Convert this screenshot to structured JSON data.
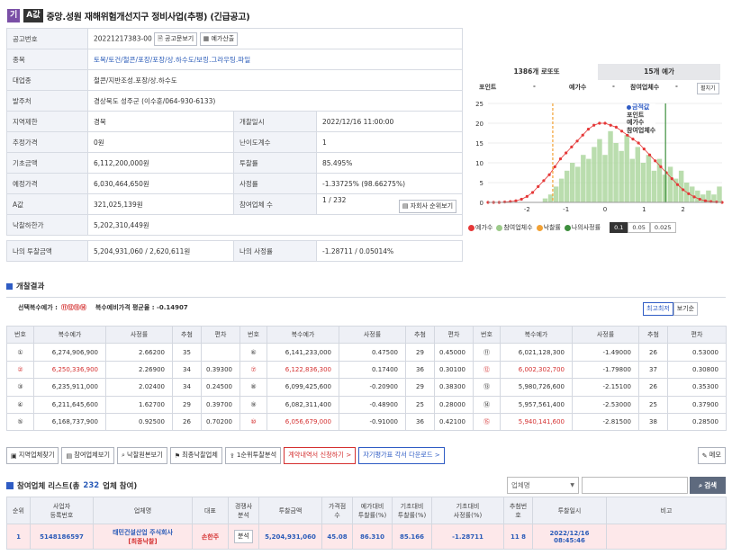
{
  "header": {
    "badge1": "기",
    "badge2": "A값",
    "title": "중앙.성원 재해위험개선지구 정비사업(추평) (긴급공고)"
  },
  "info": {
    "notice_no_label": "공고번호",
    "notice_no": "20221217383-00",
    "notice_btn": "공고문보기",
    "calc_btn": "예가산출",
    "category_label": "종목",
    "categories": "토목/토건/철콘/포장/포장/상.하수도/보링.그라우팅.파일",
    "rep_label": "대업종",
    "rep": "철콘/지반조성.포장/상.하수도",
    "issuer_label": "발주처",
    "issuer": "경상북도 성주군 (이수훈/064-930-6133)",
    "region_label": "지역제한",
    "region": "경북",
    "open_label": "개찰일시",
    "open": "2022/12/16 11:00:00",
    "est_label": "추정가격",
    "est": "0원",
    "diff_label": "난이도계수",
    "diff": "1",
    "base_label": "기초금액",
    "base": "6,112,200,000원",
    "rate_label": "투찰률",
    "rate": "85.495%",
    "pre_label": "예정가격",
    "pre": "6,030,464,650원",
    "srate_label": "사정률",
    "srate": "-1.33725% (98.66275%)",
    "a_label": "A값",
    "a": "321,025,139원",
    "part_label": "참여업체 수",
    "part": "1 / 232",
    "my_btn": "자회사 순위보기",
    "low_label": "낙찰하한가",
    "low": "5,202,310,449원",
    "my_bid_label": "나의 투찰금액",
    "my_bid": "5,204,931,060 / 2,620,611원",
    "my_rate_label": "나의 사정률",
    "my_rate": "-1.28711 / 0.05014%"
  },
  "chart": {
    "tab1": "1386개 로또또",
    "tab2": "15개 예가",
    "row_labels": [
      "포인트",
      "-",
      "예가수",
      "-",
      "참여업체수",
      "-"
    ],
    "detail_btn": "펼치기",
    "hover": [
      "금적값",
      "포인트",
      "예가수",
      "참여업체수"
    ],
    "legend": [
      "예가수",
      "참여업체수",
      "낙찰률",
      "나의사정률"
    ],
    "seg": [
      "0.1",
      "0.05",
      "0.025"
    ]
  },
  "chart_data": {
    "type": "line",
    "xlim": [
      -3,
      3
    ],
    "ylim": [
      0,
      25
    ],
    "xticks": [
      "-2",
      "-1",
      "0",
      "1",
      "2"
    ],
    "yticks": [
      "25",
      "20",
      "15",
      "10",
      "5",
      "0"
    ],
    "series": [
      {
        "name": "예가수",
        "values": [
          0,
          0,
          0,
          0.1,
          0.2,
          0.4,
          0.8,
          1.5,
          2.5,
          4,
          5.5,
          7,
          9,
          11,
          12.5,
          14,
          15.5,
          17,
          18.5,
          19.5,
          20,
          20,
          19.5,
          19,
          18,
          17,
          16,
          15,
          13.5,
          12,
          10.5,
          9,
          7.5,
          6,
          4.5,
          3.2,
          2.2,
          1.4,
          0.8,
          0.4,
          0.2,
          0.1,
          0
        ]
      },
      {
        "name": "참여업체수",
        "values": [
          0,
          0,
          0,
          0,
          0,
          0,
          0,
          0,
          0,
          0,
          1,
          2,
          4,
          6,
          8,
          10,
          9,
          12,
          11,
          14,
          16,
          12,
          18,
          15,
          13,
          17,
          11,
          14,
          10,
          12,
          8,
          11,
          7,
          9,
          6,
          8,
          5,
          4,
          3,
          2,
          3,
          2,
          4
        ]
      }
    ],
    "markers": {
      "low_rate": -1.34,
      "my_rate": 1.55
    }
  },
  "results": {
    "title": "개찰결과",
    "sel_label": "선택복수예가 :",
    "sel_marks": "⑪⑫⑬⑭",
    "avg_label": "복수예비가격 평균율 : -0.14907",
    "btn_max": "최고최저",
    "btn_view": "보기순",
    "headers": [
      "번호",
      "복수예가",
      "사정률",
      "추첨",
      "편차"
    ],
    "rows": [
      [
        {
          "n": "①",
          "v": "6,274,906,900",
          "r": "2.66200",
          "c": "35",
          "d": ""
        },
        {
          "n": "⑥",
          "v": "6,141,233,000",
          "r": "0.47500",
          "c": "29",
          "d": "0.45000"
        },
        {
          "n": "⑪",
          "v": "6,021,128,300",
          "r": "-1.49000",
          "c": "26",
          "d": "0.53000"
        }
      ],
      [
        {
          "n": "②",
          "v": "6,250,336,900",
          "r": "2.26900",
          "c": "34",
          "d": "0.39300"
        },
        {
          "n": "⑦",
          "v": "6,122,836,300",
          "r": "0.17400",
          "c": "36",
          "d": "0.30100"
        },
        {
          "n": "⑫",
          "v": "6,002,302,700",
          "r": "-1.79800",
          "c": "37",
          "d": "0.30800"
        }
      ],
      [
        {
          "n": "③",
          "v": "6,235,911,000",
          "r": "2.02400",
          "c": "34",
          "d": "0.24500"
        },
        {
          "n": "⑧",
          "v": "6,099,425,600",
          "r": "-0.20900",
          "c": "29",
          "d": "0.38300"
        },
        {
          "n": "⑬",
          "v": "5,980,726,600",
          "r": "-2.15100",
          "c": "26",
          "d": "0.35300"
        }
      ],
      [
        {
          "n": "④",
          "v": "6,211,645,600",
          "r": "1.62700",
          "c": "29",
          "d": "0.39700"
        },
        {
          "n": "⑨",
          "v": "6,082,311,400",
          "r": "-0.48900",
          "c": "25",
          "d": "0.28000"
        },
        {
          "n": "⑭",
          "v": "5,957,561,400",
          "r": "-2.53000",
          "c": "25",
          "d": "0.37900"
        }
      ],
      [
        {
          "n": "⑤",
          "v": "6,168,737,900",
          "r": "0.92500",
          "c": "26",
          "d": "0.70200"
        },
        {
          "n": "⑩",
          "v": "6,056,679,000",
          "r": "-0.91000",
          "c": "36",
          "d": "0.42100"
        },
        {
          "n": "⑮",
          "v": "5,940,141,600",
          "r": "-2.81500",
          "c": "38",
          "d": "0.28500"
        }
      ]
    ]
  },
  "actions": [
    "지역업체찾기",
    "참여업체보기",
    "낙찰원본보기",
    "최종낙찰업체",
    "1순위투찰분석",
    "계약내역서 신청하기 >",
    "자기평가표 각서 다운로드 >",
    "메모"
  ],
  "participants": {
    "title": "참여업체 리스트(총",
    "count": "232",
    "title_end": "업체 참여)",
    "select": "업체명",
    "search_btn": "검색",
    "headers": [
      "순위",
      "사업자\n등록번호",
      "업체명",
      "대표",
      "경쟁사\n분석",
      "투찰금액",
      "가격점\n수",
      "예가대비\n투찰률(%)",
      "기초대비\n투찰률(%)",
      "기초대비\n사정률(%)",
      "추첨번\n호",
      "투찰일시",
      "비고"
    ],
    "row": {
      "rank": "1",
      "bizno": "5148186597",
      "name": "태민건설산업 주식회사",
      "tag": "[최종낙찰]",
      "ceo": "손한주",
      "btn": "분석",
      "amount": "5,204,931,060",
      "score": "45.08",
      "r1": "86.310",
      "r2": "85.166",
      "r3": "-1.28711",
      "draw": "11 8",
      "date": "2022/12/16",
      "time": "08:45:46"
    }
  }
}
